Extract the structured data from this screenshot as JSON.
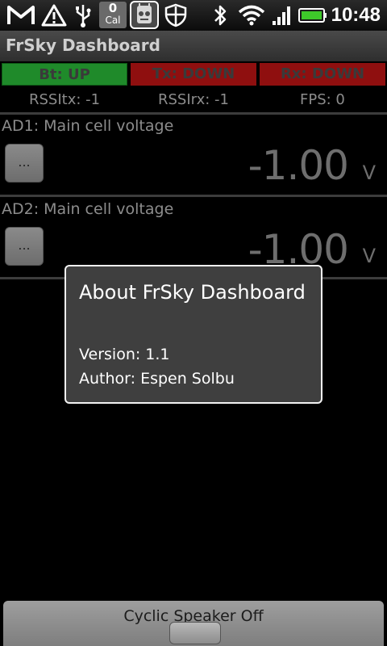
{
  "status_bar": {
    "icons": [
      "gmail-icon",
      "warning-icon",
      "usb-icon",
      "calendar-icon",
      "app-notification-icon",
      "shield-icon",
      "bluetooth-icon",
      "wifi-icon",
      "signal-icon",
      "battery-icon"
    ],
    "calendar_day": "0",
    "calendar_label": "Cal",
    "time": "10:48",
    "battery_color": "#3ec92a"
  },
  "app": {
    "title": "FrSky Dashboard"
  },
  "link_status": {
    "bt": "Bt: UP",
    "tx": "Tx: DOWN",
    "rx": "Rx: DOWN",
    "up_color": "#1f8a2a",
    "down_color": "#8f0f0f"
  },
  "stats": {
    "rssi_tx": "RSSItx: -1",
    "rssi_rx": "RSSIrx: -1",
    "fps": "FPS: 0"
  },
  "channels": [
    {
      "label": "AD1: Main cell voltage",
      "button": "...",
      "value": "-1.00",
      "unit": "V"
    },
    {
      "label": "AD2: Main cell voltage",
      "button": "...",
      "value": "-1.00",
      "unit": "V"
    }
  ],
  "dialog": {
    "title": "About FrSky Dashboard",
    "version": "Version: 1.1",
    "author": "Author: Espen Solbu"
  },
  "bottom_button": {
    "label": "Cyclic Speaker Off"
  }
}
